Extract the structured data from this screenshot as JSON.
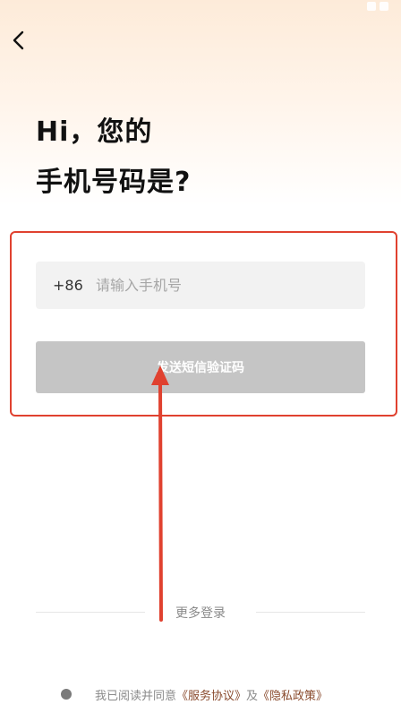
{
  "header": {
    "title_line1": "Hi，您的",
    "title_line2": "手机号码是?"
  },
  "phone_form": {
    "country_code": "+86",
    "phone_placeholder": "请输入手机号",
    "phone_value": ""
  },
  "send_code_button": {
    "label": "发送短信验证码"
  },
  "more_login": {
    "label": "更多登录"
  },
  "agreement": {
    "prefix": "我已阅读并同意",
    "service_link": "《服务协议》",
    "connector": "及",
    "privacy_link": "《隐私政策》"
  },
  "colors": {
    "annotation": "#e0412f",
    "button_disabled": "#c5c5c5",
    "link": "#8a4b2e"
  }
}
